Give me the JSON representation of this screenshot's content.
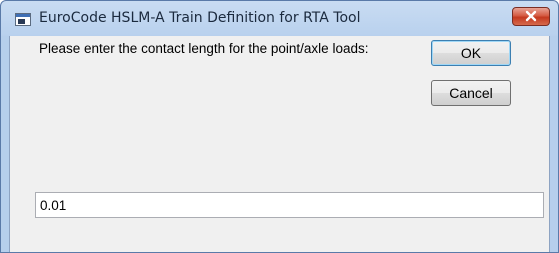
{
  "window": {
    "title": "EuroCode HSLM-A Train Definition for RTA Tool",
    "close_icon": "close-icon",
    "app_icon": "app-window-icon"
  },
  "dialog": {
    "prompt": "Please enter the contact length for the point/axle loads:",
    "input_value": "0.01",
    "ok_label": "OK",
    "cancel_label": "Cancel"
  },
  "colors": {
    "titlebar": "#b9d1ee",
    "client_background": "#f0f0f0",
    "close_button": "#c4391f",
    "default_button_border": "#3c7fb1"
  }
}
